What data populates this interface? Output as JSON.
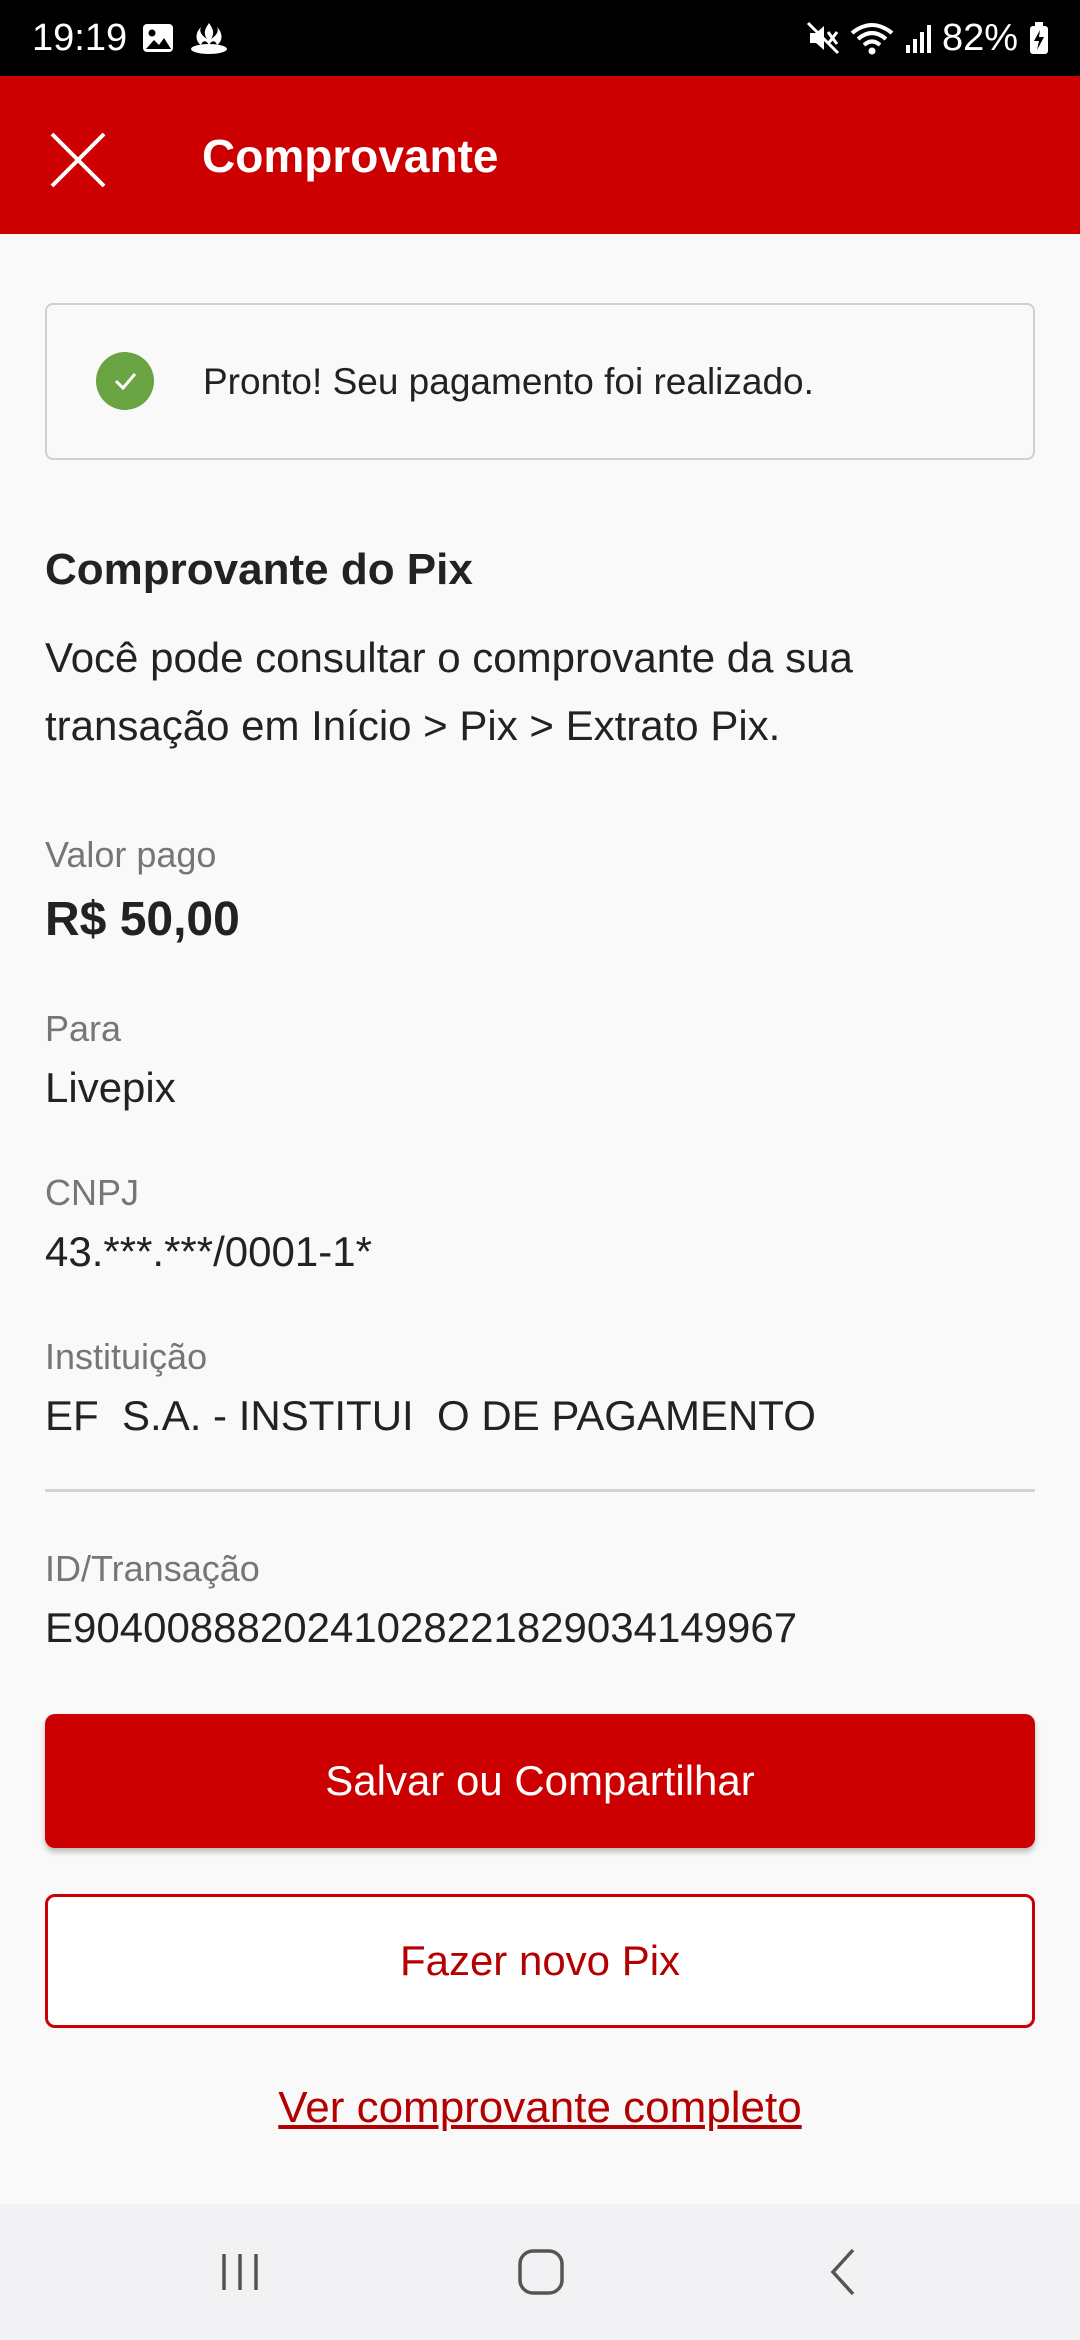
{
  "status_bar": {
    "time": "19:19",
    "battery": "82%",
    "icons": [
      "image-icon",
      "santander-flame-icon",
      "mute-icon",
      "wifi-icon",
      "signal-icon",
      "battery-charging-icon"
    ]
  },
  "header": {
    "title": "Comprovante",
    "close_icon": "close-icon",
    "color": "#cc0000"
  },
  "success": {
    "message": "Pronto! Seu pagamento foi realizado.",
    "icon": "check-circle-icon",
    "color": "#6aa341"
  },
  "receipt": {
    "title": "Comprovante do Pix",
    "description": "Você pode consultar o comprovante da sua transação em Início > Pix > Extrato Pix.",
    "fields": [
      {
        "label": "Valor pago",
        "value": "R$ 50,00"
      },
      {
        "label": "Para",
        "value": "Livepix"
      },
      {
        "label": "CNPJ",
        "value": "43.***.***/0001-1*"
      },
      {
        "label": "Instituição",
        "value": "EF  S.A. - INSTITUI  O DE PAGAMENTO"
      },
      {
        "label": "ID/Transação",
        "value": "E90400888202410282218290341499​67"
      }
    ]
  },
  "actions": {
    "primary_label": "Salvar ou Compartilhar",
    "secondary_label": "Fazer novo Pix",
    "link_label": "Ver comprovante completo"
  },
  "nav": {
    "icons": [
      "recent-apps-icon",
      "home-icon",
      "back-icon"
    ]
  }
}
